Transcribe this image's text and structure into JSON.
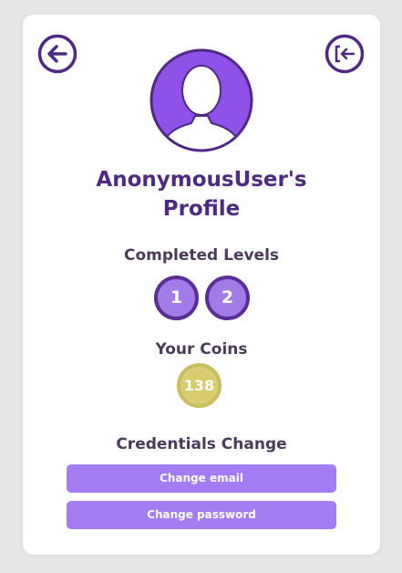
{
  "profile": {
    "title_line1": "AnonymousUser's",
    "title_line2": "Profile"
  },
  "levels": {
    "heading": "Completed Levels",
    "items": [
      "1",
      "2"
    ]
  },
  "coins": {
    "heading": "Your Coins",
    "value": "138"
  },
  "credentials": {
    "heading": "Credentials Change",
    "change_email_label": "Change email",
    "change_password_label": "Change password"
  },
  "icons": {
    "back": "arrow-left-circle-icon",
    "logout": "logout-icon",
    "avatar": "user-silhouette-icon"
  },
  "colors": {
    "primary_dark": "#4e2a84",
    "accent_purple": "#a37bf2",
    "badge_border": "#5a2d97",
    "coin_gold": "#d8cd6c",
    "background": "#e6e6e8"
  }
}
